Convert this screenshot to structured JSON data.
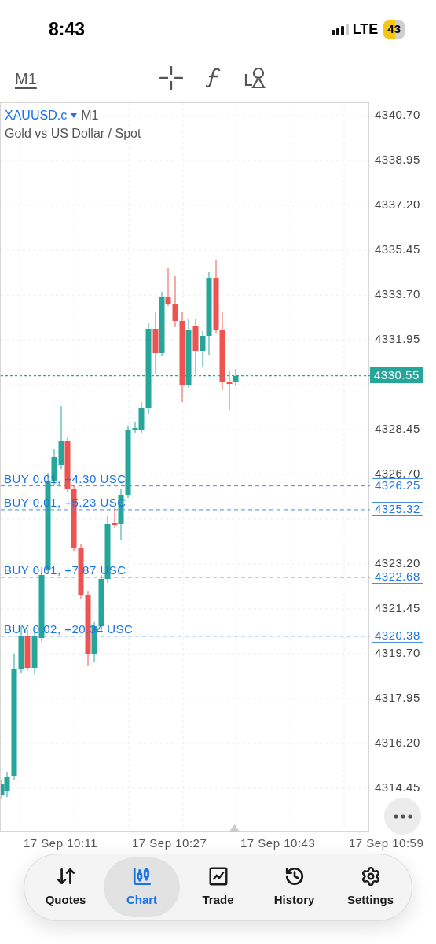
{
  "status_bar": {
    "time": "8:43",
    "network": "LTE",
    "battery": "43"
  },
  "toolbar": {
    "timeframe": "M1"
  },
  "chart": {
    "symbol": "XAUUSD.c",
    "timeframe": "M1",
    "description": "Gold vs US Dollar / Spot",
    "price_axis": [
      "4340.70",
      "4338.95",
      "4337.20",
      "4335.45",
      "4333.70",
      "4331.95",
      "4328.45",
      "4326.70",
      "4323.20",
      "4321.45",
      "4319.70",
      "4317.95",
      "4316.20",
      "4314.45"
    ],
    "current_price": "4330.55",
    "orders": [
      {
        "label": "BUY 0.01, +4.30 USC",
        "price": "4326.25"
      },
      {
        "label": "BUY 0.01, +5.23 USC",
        "price": "4325.32"
      },
      {
        "label": "BUY 0.01, +7.87 USC",
        "price": "4322.68"
      },
      {
        "label": "BUY 0.02, +20.34 USC",
        "price": "4320.38"
      }
    ],
    "time_axis": [
      "17 Sep 10:11",
      "17 Sep 10:27",
      "17 Sep 10:43",
      "17 Sep 10:59"
    ]
  },
  "nav": [
    {
      "label": "Quotes",
      "selected": false
    },
    {
      "label": "Chart",
      "selected": true
    },
    {
      "label": "Trade",
      "selected": false
    },
    {
      "label": "History",
      "selected": false
    },
    {
      "label": "Settings",
      "selected": false
    }
  ]
}
